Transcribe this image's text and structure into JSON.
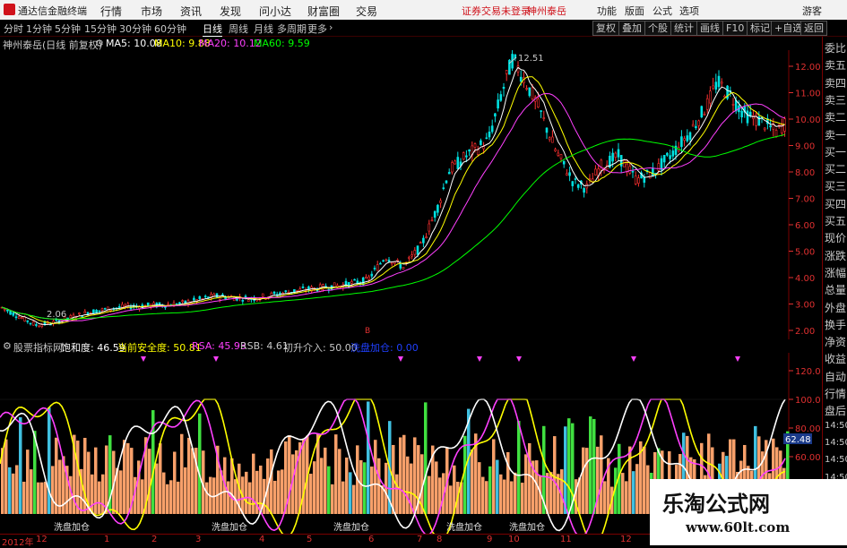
{
  "titlebar": {
    "app_name": "通达信金融终端",
    "menus": [
      "行情",
      "市场",
      "资讯",
      "发现",
      "问小达",
      "财富圈",
      "交易"
    ],
    "login_status": "证券交易未登录",
    "stock_name": "神州泰岳",
    "tools": [
      "功能",
      "版面",
      "公式",
      "选项"
    ],
    "guest": "游客"
  },
  "periods": [
    "分时",
    "1分钟",
    "5分钟",
    "15分钟",
    "30分钟",
    "60分钟",
    "日线",
    "周线",
    "月线",
    "多周期",
    "更多"
  ],
  "active_period": "日线",
  "right_tools": [
    "复权",
    "叠加",
    "个股",
    "统计",
    "画线",
    "F10",
    "标记",
    "+自选",
    "返回"
  ],
  "chart_info": {
    "stock": "神州泰岳(日线 前复权)",
    "ma5": "MA5: 10.08",
    "ma10": "MA10: 9.88",
    "ma20": "MA20: 10.12",
    "ma60": "MA60: 9.59",
    "colors": {
      "ma5": "#ffffff",
      "ma10": "#ffff00",
      "ma20": "#ff40ff",
      "ma60": "#00ff00"
    }
  },
  "main_axis": [
    "12.00",
    "11.00",
    "10.00",
    "9.00",
    "8.00",
    "7.00",
    "6.00",
    "5.00",
    "4.00",
    "3.00",
    "2.00"
  ],
  "high_label": "12.51",
  "low_label": "2.06",
  "indicator_info": {
    "name": "股票指标网",
    "saturation": "饱和度: 46.59",
    "safety": "当前安全度: 50.81",
    "rsa": "RSA: 45.93",
    "rsb": "RSB: 4.61",
    "entry": "初升介入: 50.00",
    "wash": "洗盘加仓: 0.00"
  },
  "ind_axis": [
    "120.0",
    "100.0",
    "80.00",
    "60.00"
  ],
  "ind_current": "62.48",
  "wash_labels": [
    "洗盘加仓",
    "洗盘加仓",
    "洗盘加仓",
    "洗盘加仓",
    "洗盘加仓"
  ],
  "right_panel": [
    "委比",
    "卖五",
    "卖四",
    "卖三",
    "卖二",
    "卖一",
    "买一",
    "买二",
    "买三",
    "买四",
    "买五",
    "现价",
    "涨跌",
    "涨幅",
    "总量",
    "外盘",
    "换手",
    "净资",
    "收益",
    "自动",
    "行情",
    "盘后",
    "14:50",
    "14:50",
    "14:50",
    "14:50",
    "14:50",
    "14:50"
  ],
  "date_labels": [
    "2012年",
    "12",
    "1",
    "2",
    "3",
    "4",
    "5",
    "6",
    "7",
    "8",
    "9",
    "10",
    "11",
    "12"
  ],
  "watermark": {
    "title": "乐淘公式网",
    "url": "www.60lt.com"
  },
  "marker_b": "B"
}
